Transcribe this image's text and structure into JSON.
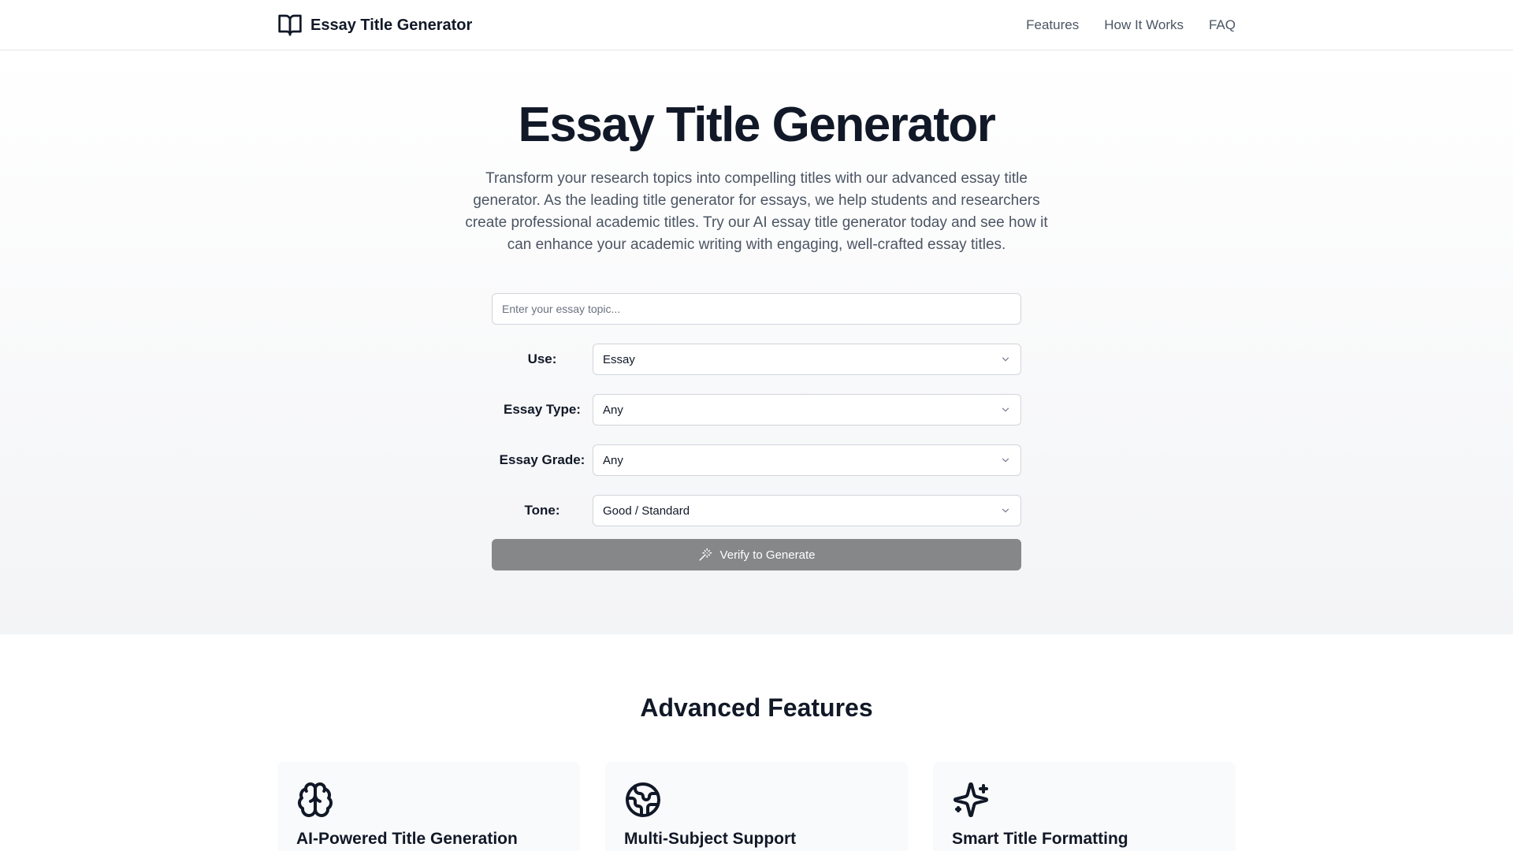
{
  "header": {
    "brand": "Essay Title Generator",
    "nav": [
      "Features",
      "How It Works",
      "FAQ"
    ]
  },
  "hero": {
    "title": "Essay Title Generator",
    "description": "Transform your research topics into compelling titles with our advanced essay title generator. As the leading title generator for essays, we help students and researchers create professional academic titles. Try our AI essay title generator today and see how it can enhance your academic writing with engaging, well-crafted essay titles."
  },
  "form": {
    "topic_placeholder": "Enter your essay topic...",
    "fields": [
      {
        "label": "Use:",
        "value": "Essay"
      },
      {
        "label": "Essay Type:",
        "value": "Any"
      },
      {
        "label": "Essay Grade:",
        "value": "Any"
      },
      {
        "label": "Tone:",
        "value": "Good / Standard"
      }
    ],
    "button_label": "Verify to Generate"
  },
  "features": {
    "title": "Advanced Features",
    "cards": [
      {
        "icon": "brain-icon",
        "title": "AI-Powered Title Generation"
      },
      {
        "icon": "globe-icon",
        "title": "Multi-Subject Support"
      },
      {
        "icon": "sparkles-icon",
        "title": "Smart Title Formatting"
      }
    ]
  },
  "colors": {
    "button_bg": "#868788",
    "text_primary": "#111827",
    "text_muted": "#4b5563",
    "border": "#d1d5db"
  }
}
